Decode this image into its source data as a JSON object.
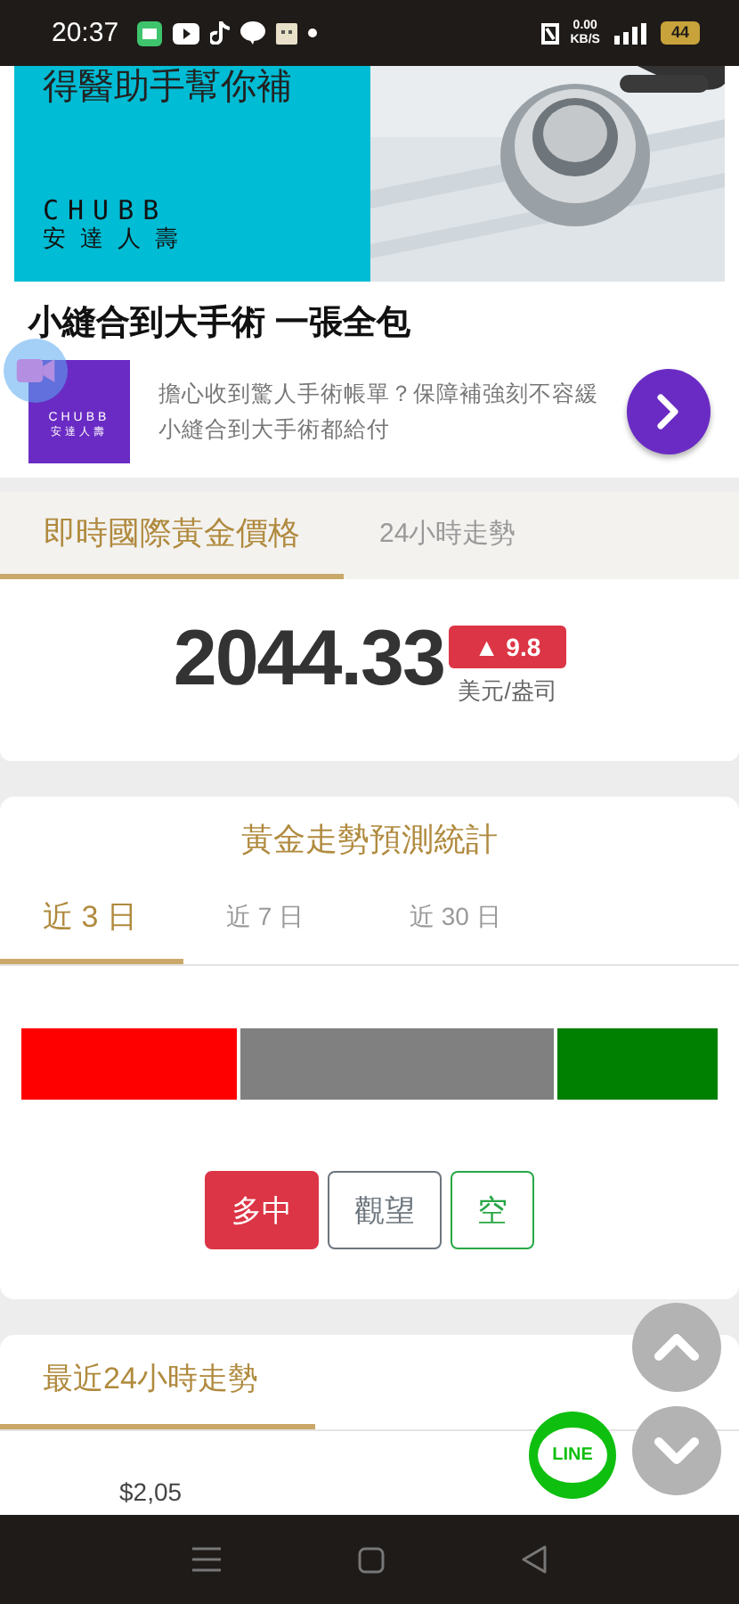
{
  "status_bar": {
    "time": "20:37",
    "net_speed": "0.00",
    "net_unit": "KB/S",
    "battery": "44"
  },
  "ad": {
    "banner_text": "得醫助手幫你補",
    "brand": "CHUBB",
    "brand_sub": "安達人壽",
    "title": "小縫合到大手術 一張全包",
    "logo_brand": "CHUBB",
    "logo_sub": "安達人壽",
    "description": [
      "擔心收到驚人手術帳單？保障補強刻不容緩",
      "小縫合到大手術都給付"
    ]
  },
  "price_tabs": [
    {
      "label": "即時國際黃金價格",
      "selected": true
    },
    {
      "label": "24小時走勢",
      "selected": false
    }
  ],
  "price": {
    "value": "2044.33",
    "change": "▲ 9.8",
    "unit": "美元/盎司"
  },
  "forecast": {
    "title": "黃金走勢預測統計",
    "periods": [
      {
        "label": "近 3 日",
        "selected": true
      },
      {
        "label": "近 7 日",
        "selected": false
      },
      {
        "label": "近 30 日",
        "selected": false
      }
    ],
    "segments": [
      {
        "color": "#ff0000"
      },
      {
        "color": "#808080"
      },
      {
        "color": "#008000"
      }
    ],
    "buttons": [
      {
        "label": "多中",
        "kind": "filled",
        "color": "#dc3545"
      },
      {
        "label": "觀望",
        "kind": "outline",
        "color": "#6c757d"
      },
      {
        "label": "空",
        "kind": "outline",
        "color": "#28a745"
      }
    ]
  },
  "trend": {
    "title": "最近24小時走勢",
    "axis_label": "$2,05"
  },
  "line_button": {
    "label": "LINE"
  }
}
